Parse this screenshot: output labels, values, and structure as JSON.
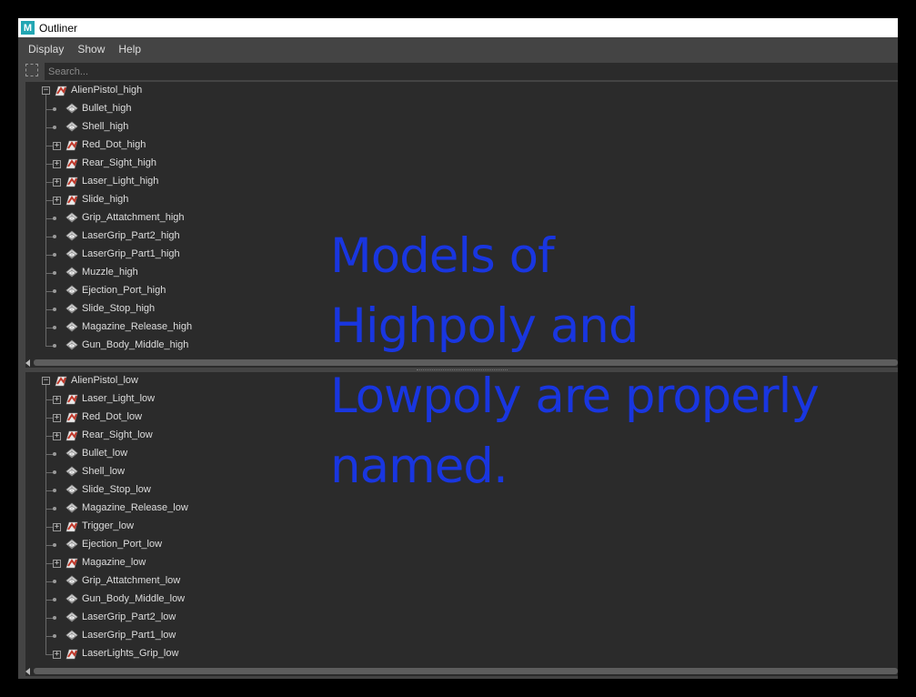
{
  "window": {
    "title": "Outliner",
    "app_icon": "maya-logo",
    "app_logo_letter": "M"
  },
  "menu": [
    "Display",
    "Show",
    "Help"
  ],
  "search": {
    "placeholder": "Search..."
  },
  "colors": {
    "panel_bg": "#2b2b2b",
    "window_bg": "#444444",
    "overlay_text": "#1936e0",
    "group_icon": "#c0392b"
  },
  "outliner_top": {
    "root": {
      "label": "AlienPistol_high",
      "icon": "group-transform-icon",
      "expanded": true
    },
    "children": [
      {
        "label": "Bullet_high",
        "icon": "mesh-icon",
        "expandable": false
      },
      {
        "label": "Shell_high",
        "icon": "mesh-icon",
        "expandable": false
      },
      {
        "label": "Red_Dot_high",
        "icon": "group-transform-icon",
        "expandable": true
      },
      {
        "label": "Rear_Sight_high",
        "icon": "group-transform-icon",
        "expandable": true
      },
      {
        "label": "Laser_Light_high",
        "icon": "group-transform-icon",
        "expandable": true
      },
      {
        "label": "Slide_high",
        "icon": "group-transform-icon",
        "expandable": true
      },
      {
        "label": "Grip_Attatchment_high",
        "icon": "mesh-icon",
        "expandable": false
      },
      {
        "label": "LaserGrip_Part2_high",
        "icon": "mesh-icon",
        "expandable": false
      },
      {
        "label": "LaserGrip_Part1_high",
        "icon": "mesh-icon",
        "expandable": false
      },
      {
        "label": "Muzzle_high",
        "icon": "mesh-icon",
        "expandable": false
      },
      {
        "label": "Ejection_Port_high",
        "icon": "mesh-icon",
        "expandable": false
      },
      {
        "label": "Slide_Stop_high",
        "icon": "mesh-icon",
        "expandable": false
      },
      {
        "label": "Magazine_Release_high",
        "icon": "mesh-icon",
        "expandable": false
      },
      {
        "label": "Gun_Body_Middle_high",
        "icon": "mesh-icon",
        "expandable": false
      }
    ]
  },
  "outliner_bottom": {
    "root": {
      "label": "AlienPistol_low",
      "icon": "group-transform-icon",
      "expanded": true
    },
    "children": [
      {
        "label": "Laser_Light_low",
        "icon": "group-transform-icon",
        "expandable": true
      },
      {
        "label": "Red_Dot_low",
        "icon": "group-transform-icon",
        "expandable": true
      },
      {
        "label": "Rear_Sight_low",
        "icon": "group-transform-icon",
        "expandable": true
      },
      {
        "label": "Bullet_low",
        "icon": "mesh-icon",
        "expandable": false
      },
      {
        "label": "Shell_low",
        "icon": "mesh-icon",
        "expandable": false
      },
      {
        "label": "Slide_Stop_low",
        "icon": "mesh-icon",
        "expandable": false
      },
      {
        "label": "Magazine_Release_low",
        "icon": "mesh-icon",
        "expandable": false
      },
      {
        "label": "Trigger_low",
        "icon": "group-transform-icon",
        "expandable": true
      },
      {
        "label": "Ejection_Port_low",
        "icon": "mesh-icon",
        "expandable": false
      },
      {
        "label": "Magazine_low",
        "icon": "group-transform-icon",
        "expandable": true
      },
      {
        "label": "Grip_Attatchment_low",
        "icon": "mesh-icon",
        "expandable": false
      },
      {
        "label": "Gun_Body_Middle_low",
        "icon": "mesh-icon",
        "expandable": false
      },
      {
        "label": "LaserGrip_Part2_low",
        "icon": "mesh-icon",
        "expandable": false
      },
      {
        "label": "LaserGrip_Part1_low",
        "icon": "mesh-icon",
        "expandable": false
      },
      {
        "label": "LaserLights_Grip_low",
        "icon": "group-transform-icon",
        "expandable": true
      }
    ]
  },
  "overlay_caption": [
    "Models of",
    "Highpoly and",
    "Lowpoly are properly",
    "named."
  ]
}
